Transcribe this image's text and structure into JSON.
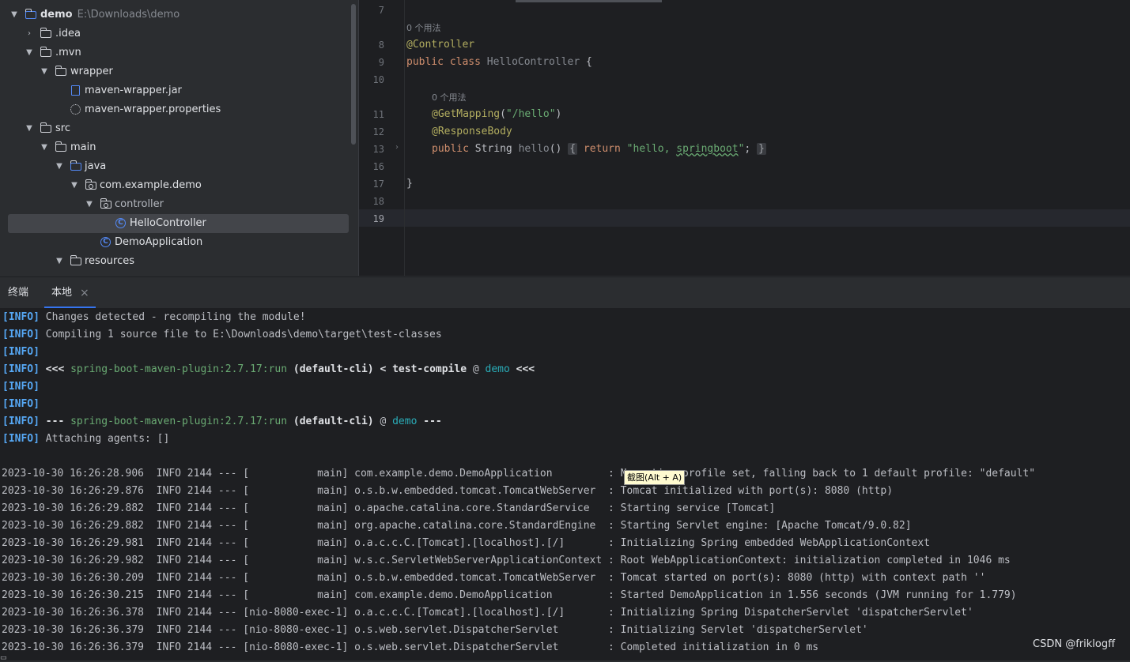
{
  "tree": {
    "rows": [
      {
        "label": "demo",
        "extra": "E:\\Downloads\\demo",
        "bold": true
      },
      {
        "label": ".idea"
      },
      {
        "label": ".mvn"
      },
      {
        "label": "wrapper"
      },
      {
        "label": "maven-wrapper.jar"
      },
      {
        "label": "maven-wrapper.properties"
      },
      {
        "label": "src"
      },
      {
        "label": "main"
      },
      {
        "label": "java"
      },
      {
        "label": "com.example.demo"
      },
      {
        "label": "controller"
      },
      {
        "label": "HelloController"
      },
      {
        "label": "DemoApplication"
      },
      {
        "label": "resources"
      }
    ]
  },
  "editor": {
    "line_numbers": [
      "7",
      "8",
      "9",
      "10",
      "11",
      "12",
      "13",
      "16",
      "17",
      "18",
      "19"
    ],
    "usage_hint": "0 个用法",
    "code": {
      "annotation_controller": "@Controller",
      "kw_public": "public",
      "kw_class": "class",
      "class_name": "HelloController",
      "brace_open": " {",
      "annotation_getmapping": "@GetMapping",
      "getmapping_paren_open": "(",
      "getmapping_path": "\"/hello\"",
      "getmapping_paren_close": ")",
      "annotation_responsebody": "@ResponseBody",
      "kw_public2": "public",
      "type_string": " String ",
      "method_name": "hello",
      "method_parens": "()",
      "fold_open": "{",
      "kw_return": "return",
      "string_prefix": "\"hello, ",
      "string_word": "springboot",
      "string_suffix": "\"",
      "semicolon": ";",
      "fold_close": "}",
      "brace_close": "}"
    }
  },
  "terminal": {
    "tabs": [
      {
        "label": "终端"
      },
      {
        "label": "本地"
      }
    ],
    "close_symbol": "×",
    "info_tag": "[INFO]",
    "lines": {
      "l1": " Changes detected - recompiling the module!",
      "l2": " Compiling 1 source file to E:\\Downloads\\demo\\target\\test-classes",
      "l4_a": " <<< ",
      "l4_plugin": "spring-boot-maven-plugin:2.7.17:run",
      "l4_b": " (default-cli)",
      "l4_c": " < ",
      "l4_d": "test-compile",
      "l4_e": " @ ",
      "l4_proj": "demo",
      "l4_f": " <<<",
      "l7_a": " --- ",
      "l7_plugin": "spring-boot-maven-plugin:2.7.17:run",
      "l7_b": " (default-cli)",
      "l7_c": " @ ",
      "l7_proj": "demo",
      "l7_d": " ---",
      "l8": " Attaching agents: []"
    },
    "log": [
      "2023-10-30 16:26:28.906  INFO 2144 --- [           main] com.example.demo.DemoApplication         : No active profile set, falling back to 1 default profile: \"default\"",
      "2023-10-30 16:26:29.876  INFO 2144 --- [           main] o.s.b.w.embedded.tomcat.TomcatWebServer  : Tomcat initialized with port(s): 8080 (http)",
      "2023-10-30 16:26:29.882  INFO 2144 --- [           main] o.apache.catalina.core.StandardService   : Starting service [Tomcat]",
      "2023-10-30 16:26:29.882  INFO 2144 --- [           main] org.apache.catalina.core.StandardEngine  : Starting Servlet engine: [Apache Tomcat/9.0.82]",
      "2023-10-30 16:26:29.981  INFO 2144 --- [           main] o.a.c.c.C.[Tomcat].[localhost].[/]       : Initializing Spring embedded WebApplicationContext",
      "2023-10-30 16:26:29.982  INFO 2144 --- [           main] w.s.c.ServletWebServerApplicationContext : Root WebApplicationContext: initialization completed in 1046 ms",
      "2023-10-30 16:26:30.209  INFO 2144 --- [           main] o.s.b.w.embedded.tomcat.TomcatWebServer  : Tomcat started on port(s): 8080 (http) with context path ''",
      "2023-10-30 16:26:30.215  INFO 2144 --- [           main] com.example.demo.DemoApplication         : Started DemoApplication in 1.556 seconds (JVM running for 1.779)",
      "2023-10-30 16:26:36.378  INFO 2144 --- [nio-8080-exec-1] o.a.c.c.C.[Tomcat].[localhost].[/]       : Initializing Spring DispatcherServlet 'dispatcherServlet'",
      "2023-10-30 16:26:36.379  INFO 2144 --- [nio-8080-exec-1] o.s.web.servlet.DispatcherServlet        : Initializing Servlet 'dispatcherServlet'",
      "2023-10-30 16:26:36.379  INFO 2144 --- [nio-8080-exec-1] o.s.web.servlet.DispatcherServlet        : Completed initialization in 0 ms"
    ],
    "tooltip": "截图(Alt + A)"
  },
  "watermark": "CSDN @friklogff",
  "icons": {
    "folder": "folder-icon",
    "package": "package-icon",
    "class": "class-icon",
    "jar": "jar-icon",
    "properties": "gear-icon"
  },
  "colors": {
    "annotation": "#b3ae60",
    "keyword": "#cf8e6d",
    "string": "#6aab73",
    "info": "#56a8f5",
    "accent": "#3574f0"
  }
}
